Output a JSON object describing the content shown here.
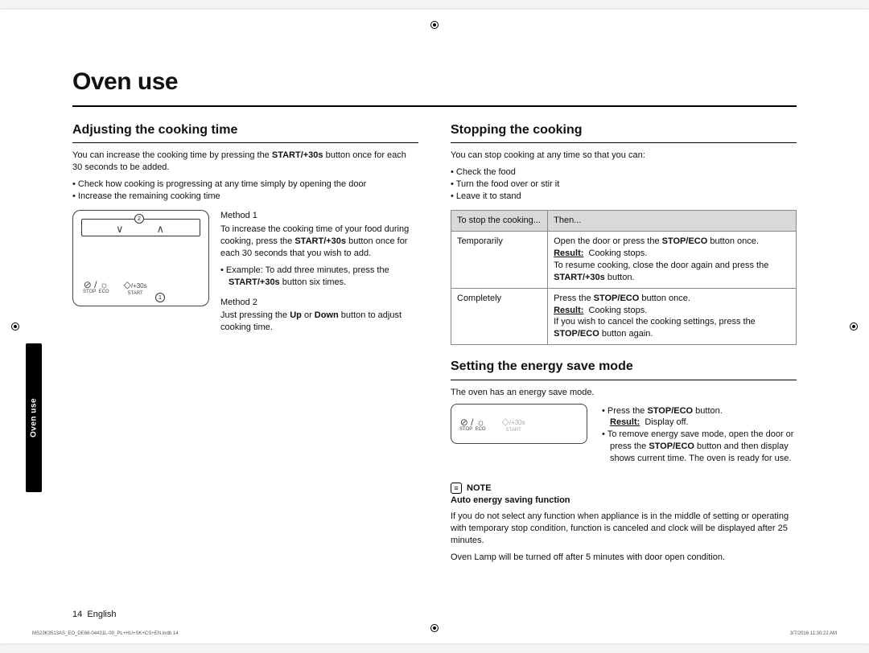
{
  "mainTitle": "Oven use",
  "sideTab": "Oven use",
  "left": {
    "subhead": "Adjusting the cooking time",
    "intro_a": "You can increase the cooking time by pressing the ",
    "intro_bold": "START/+30s",
    "intro_b": " button once for each 30 seconds to be added.",
    "bullets": [
      "Check how cooking is progressing at any time simply by opening the door",
      "Increase the remaining cooking time"
    ],
    "panel": {
      "stop": "STOP",
      "eco": "ECO",
      "start": "START",
      "plus": "/+30s",
      "tag1": "1",
      "tag2": "2"
    },
    "method1_h": "Method 1",
    "method1_a": "To increase the cooking time of your food during cooking, press the ",
    "method1_bold": "START/+30s",
    "method1_b": " button once for each 30 seconds that you wish to add.",
    "method1_ex_a": "Example: To add three minutes, press the ",
    "method1_ex_bold": "START/+30s",
    "method1_ex_b": " button six times.",
    "method2_h": "Method 2",
    "method2_a": "Just pressing the ",
    "method2_bold1": "Up",
    "method2_mid": " or ",
    "method2_bold2": "Down",
    "method2_b": " button to adjust cooking time."
  },
  "right": {
    "stop_subhead": "Stopping the cooking",
    "stop_intro": "You can stop cooking at any time so that you can:",
    "stop_bullets": [
      "Check the food",
      "Turn the food over or stir it",
      "Leave it to stand"
    ],
    "tbl": {
      "h1": "To stop the cooking...",
      "h2": "Then...",
      "r1c1": "Temporarily",
      "r1_a": "Open the door or press the ",
      "r1_bold1": "STOP/ECO",
      "r1_b": " button once.",
      "r1_res_label": "Result:",
      "r1_res": "Cooking stops.",
      "r1_c": "To resume cooking, close the door again and press the ",
      "r1_bold2": "START/+30s",
      "r1_d": " button.",
      "r2c1": "Completely",
      "r2_a": "Press the ",
      "r2_bold1": "STOP/ECO",
      "r2_b": " button once.",
      "r2_res_label": "Result:",
      "r2_res": "Cooking stops.",
      "r2_c": "If you wish to cancel the cooking settings, press the ",
      "r2_bold2": "STOP/ECO",
      "r2_d": " button again."
    },
    "energy_subhead": "Setting the energy save mode",
    "energy_intro": "The oven has an energy save mode.",
    "eco_panel": {
      "stop": "STOP",
      "eco": "ECO",
      "start": "START",
      "plus": "/+30s"
    },
    "energy_b1_a": "Press the ",
    "energy_b1_bold": "STOP/ECO",
    "energy_b1_b": " button.",
    "energy_b1_res_label": "Result:",
    "energy_b1_res": "Display off.",
    "energy_b2_a": "To remove energy save mode, open the door or press the ",
    "energy_b2_bold": "STOP/ECO",
    "energy_b2_b": " button and then display shows current time. The oven is ready for use.",
    "note_label": "NOTE",
    "note_sub": "Auto energy saving function",
    "note_p1": "If you do not select any function when appliance is in the middle of setting or operating with temporary stop condition, function is canceled and clock will be displayed after 25 minutes.",
    "note_p2": "Oven Lamp will be turned off after 5 minutes with door open condition."
  },
  "footer": {
    "page": "14",
    "lang": "English"
  },
  "print": {
    "left": "MS23K3513AS_EO_DE68-04431L-00_PL+HU+SK+CS+EN.indb   14",
    "right": "3/7/2016   11:30:22 AM"
  }
}
